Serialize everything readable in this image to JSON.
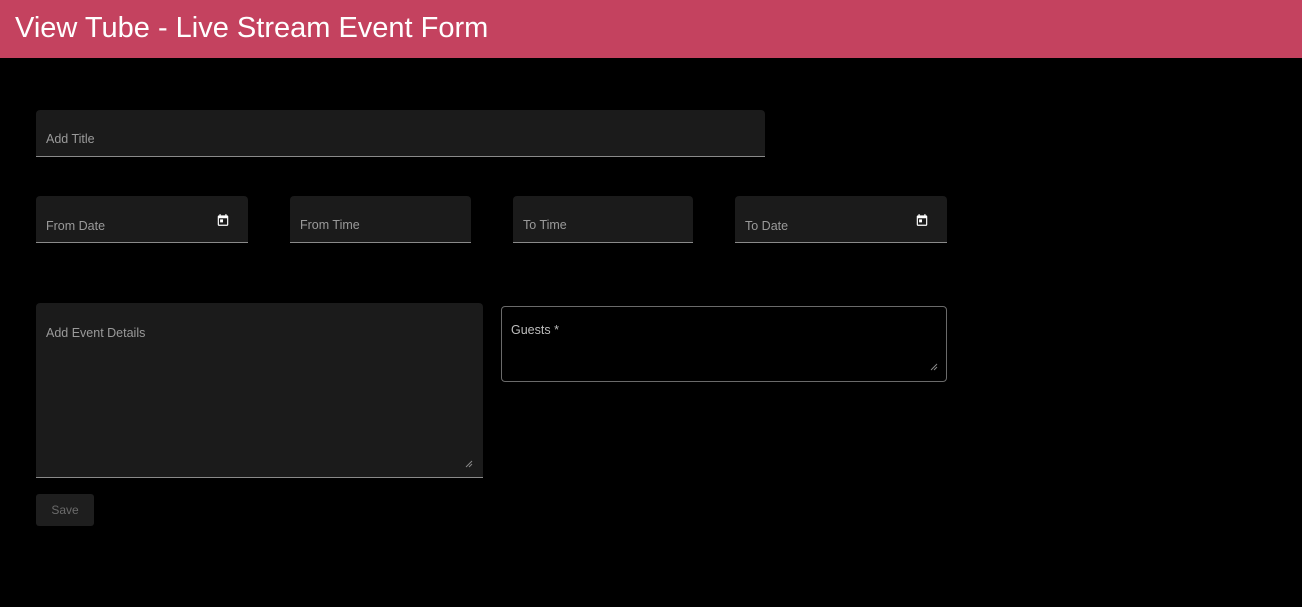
{
  "app": {
    "title": "View Tube - Live Stream Event Form"
  },
  "form": {
    "title_field": {
      "label": "Add Title",
      "value": ""
    },
    "from_date": {
      "label": "From Date",
      "value": "",
      "icon": "calendar-icon"
    },
    "from_time": {
      "label": "From Time",
      "value": ""
    },
    "to_time": {
      "label": "To Time",
      "value": ""
    },
    "to_date": {
      "label": "To Date",
      "value": "",
      "icon": "calendar-icon"
    },
    "event_details": {
      "label": "Add Event Details",
      "value": ""
    },
    "guests": {
      "label": "Guests *",
      "value": ""
    },
    "save_label": "Save"
  },
  "colors": {
    "header_bg": "#c4425f",
    "page_bg": "#000000",
    "field_bg": "#1b1b1b"
  }
}
